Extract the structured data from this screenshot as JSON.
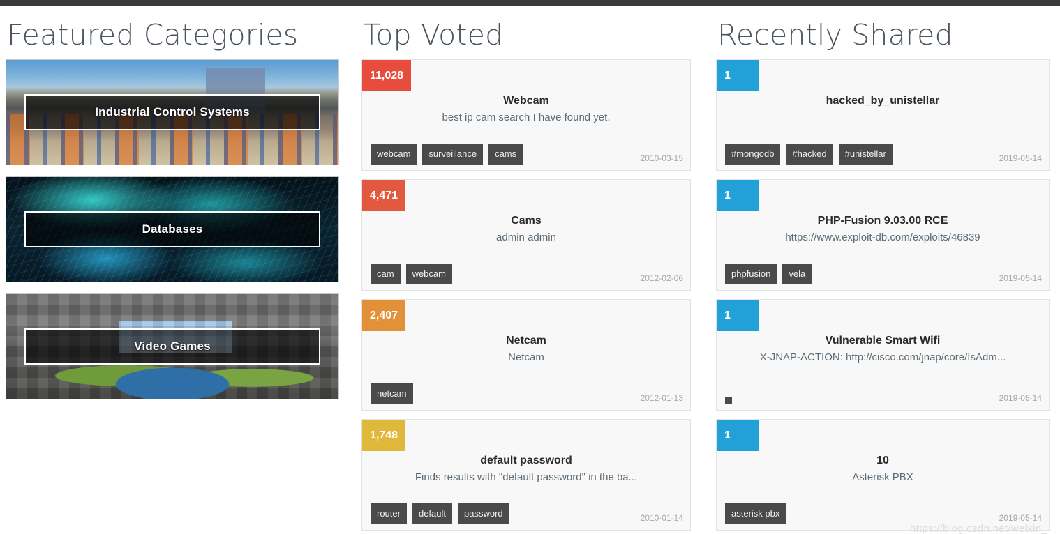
{
  "featured": {
    "title": "Featured Categories",
    "cards": [
      {
        "label": "Industrial Control Systems",
        "art": "ics"
      },
      {
        "label": "Databases",
        "art": "db"
      },
      {
        "label": "Video Games",
        "art": "vg"
      }
    ]
  },
  "top_voted": {
    "title": "Top Voted",
    "items": [
      {
        "votes": "11,028",
        "badge_color": "#e74c3c",
        "title": "Webcam",
        "desc": "best ip cam search I have found yet.",
        "tags": [
          "webcam",
          "surveillance",
          "cams"
        ],
        "date": "2010-03-15"
      },
      {
        "votes": "4,471",
        "badge_color": "#e2593f",
        "title": "Cams",
        "desc": "admin admin",
        "tags": [
          "cam",
          "webcam"
        ],
        "date": "2012-02-06"
      },
      {
        "votes": "2,407",
        "badge_color": "#e39138",
        "title": "Netcam",
        "desc": "Netcam",
        "tags": [
          "netcam"
        ],
        "date": "2012-01-13"
      },
      {
        "votes": "1,748",
        "badge_color": "#e0b83c",
        "title": "default password",
        "desc": "Finds results with \"default password\" in the ba...",
        "tags": [
          "router",
          "default",
          "password"
        ],
        "date": "2010-01-14"
      }
    ]
  },
  "recently_shared": {
    "title": "Recently Shared",
    "items": [
      {
        "votes": "1",
        "badge_color": "#21a1d8",
        "title": "hacked_by_unistellar",
        "desc": "",
        "tags": [
          "#mongodb",
          "#hacked",
          "#unistellar"
        ],
        "date": "2019-05-14"
      },
      {
        "votes": "1",
        "badge_color": "#21a1d8",
        "title": "PHP-Fusion 9.03.00 RCE",
        "desc": "https://www.exploit-db.com/exploits/46839",
        "tags": [
          "phpfusion",
          "vela"
        ],
        "date": "2019-05-14"
      },
      {
        "votes": "1",
        "badge_color": "#21a1d8",
        "title": "Vulnerable Smart Wifi",
        "desc": "X-JNAP-ACTION: http://cisco.com/jnap/core/IsAdm...",
        "tags": [
          ""
        ],
        "date": "2019-05-14"
      },
      {
        "votes": "1",
        "badge_color": "#21a1d8",
        "title": "10",
        "desc": "Asterisk PBX",
        "tags": [
          "asterisk pbx"
        ],
        "date": "2019-05-14"
      }
    ]
  },
  "watermark": "https://blog.csdn.net/weixin_"
}
